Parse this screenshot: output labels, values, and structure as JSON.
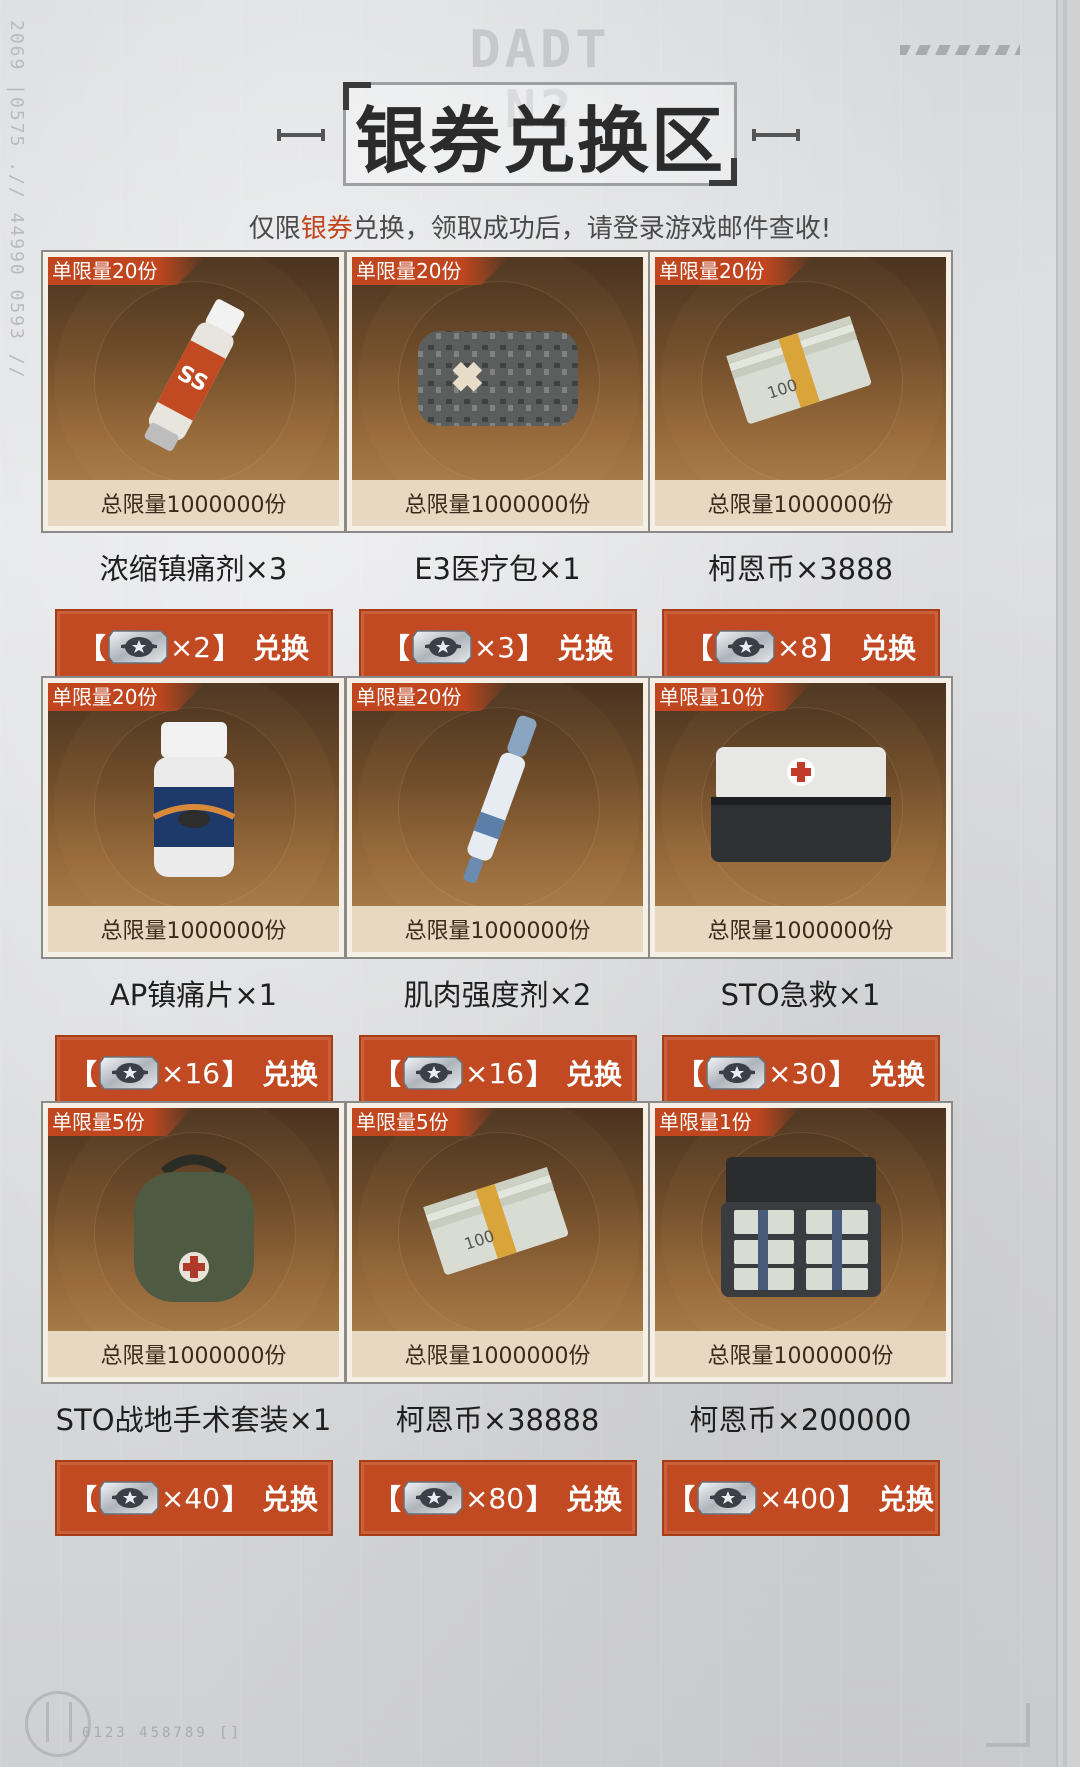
{
  "header": {
    "watermark": "DADT N2",
    "side_code": "2069 |0575 .// 44990 0593 //",
    "title": "银券兑换区",
    "subtitle_pre": "仅限",
    "subtitle_hl": "银券",
    "subtitle_post": "兑换，领取成功后，请登录游戏邮件查收!"
  },
  "items": [
    {
      "limit": "单限量20份",
      "total": "总限量1000000份",
      "name": "浓缩镇痛剂×3",
      "cost": "×2",
      "action": "兑换",
      "icon": "painkiller-tube-icon"
    },
    {
      "limit": "单限量20份",
      "total": "总限量1000000份",
      "name": "E3医疗包×1",
      "cost": "×3",
      "action": "兑换",
      "icon": "medical-pouch-icon"
    },
    {
      "limit": "单限量20份",
      "total": "总限量1000000份",
      "name": "柯恩币×3888",
      "cost": "×8",
      "action": "兑换",
      "icon": "cash-stack-icon"
    },
    {
      "limit": "单限量20份",
      "total": "总限量1000000份",
      "name": "AP镇痛片×1",
      "cost": "×16",
      "action": "兑换",
      "icon": "pill-bottle-icon"
    },
    {
      "limit": "单限量20份",
      "total": "总限量1000000份",
      "name": "肌肉强度剂×2",
      "cost": "×16",
      "action": "兑换",
      "icon": "injector-pen-icon"
    },
    {
      "limit": "单限量10份",
      "total": "总限量1000000份",
      "name": "STO急救×1",
      "cost": "×30",
      "action": "兑换",
      "icon": "first-aid-case-icon"
    },
    {
      "limit": "单限量5份",
      "total": "总限量1000000份",
      "name": "STO战地手术套装×1",
      "cost": "×40",
      "action": "兑换",
      "icon": "surgery-kit-bag-icon"
    },
    {
      "limit": "单限量5份",
      "total": "总限量1000000份",
      "name": "柯恩币×38888",
      "cost": "×80",
      "action": "兑换",
      "icon": "cash-stack-icon"
    },
    {
      "limit": "单限量1份",
      "total": "总限量1000000份",
      "name": "柯恩币×200000",
      "cost": "×400",
      "action": "兑换",
      "icon": "cash-briefcase-icon"
    }
  ],
  "footer": {
    "code": "0123  458789 []"
  },
  "colors": {
    "accent": "#c24a22",
    "badge": "#c0461f",
    "total_bar": "#e7d8c1"
  }
}
